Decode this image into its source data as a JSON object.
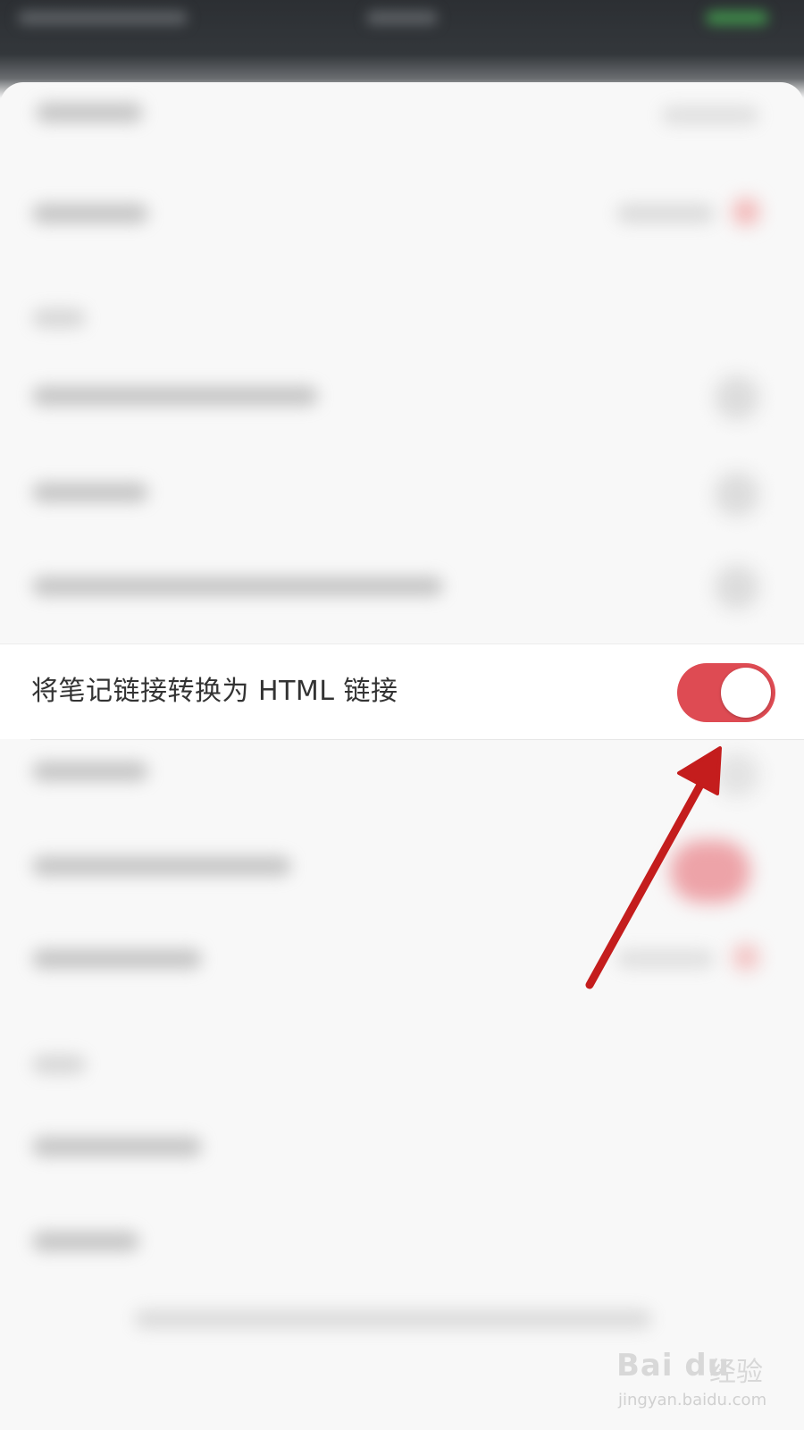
{
  "setting": {
    "label": "将笔记链接转换为 HTML 链接",
    "enabled": true
  },
  "colors": {
    "toggle_on": "#de4b53",
    "arrow": "#c41d1d",
    "status_bar": "#2c2f33"
  },
  "watermark": {
    "logo": "Bai du",
    "product": "经验",
    "url": "jingyan.baidu.com"
  }
}
